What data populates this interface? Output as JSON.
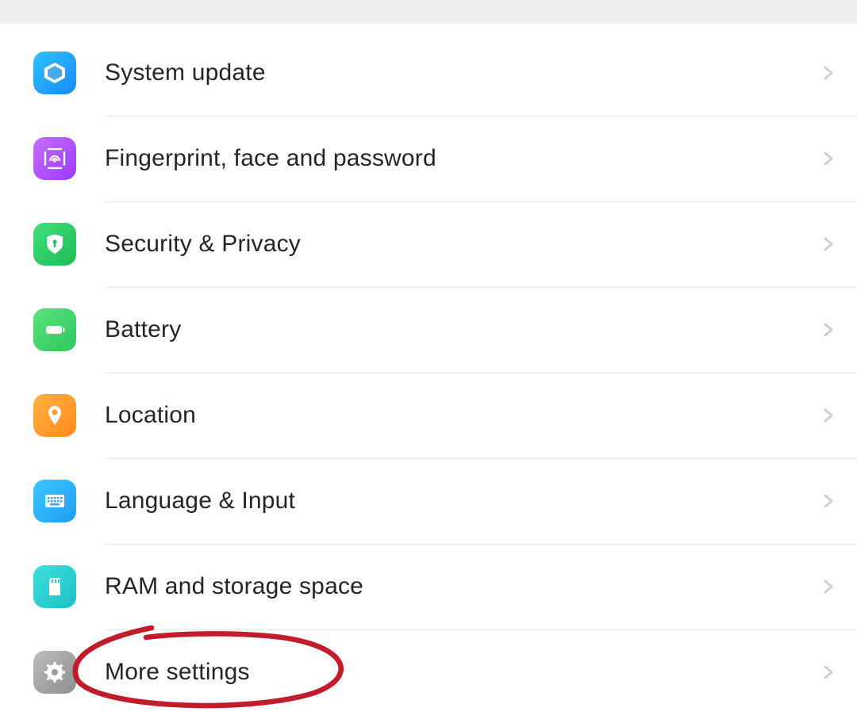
{
  "settings": {
    "items": [
      {
        "id": "system-update",
        "label": "System update"
      },
      {
        "id": "fingerprint",
        "label": "Fingerprint, face and password"
      },
      {
        "id": "security-privacy",
        "label": "Security & Privacy"
      },
      {
        "id": "battery",
        "label": "Battery"
      },
      {
        "id": "location",
        "label": "Location"
      },
      {
        "id": "language-input",
        "label": "Language & Input"
      },
      {
        "id": "ram-storage",
        "label": "RAM and storage space"
      },
      {
        "id": "more-settings",
        "label": "More settings"
      }
    ]
  }
}
